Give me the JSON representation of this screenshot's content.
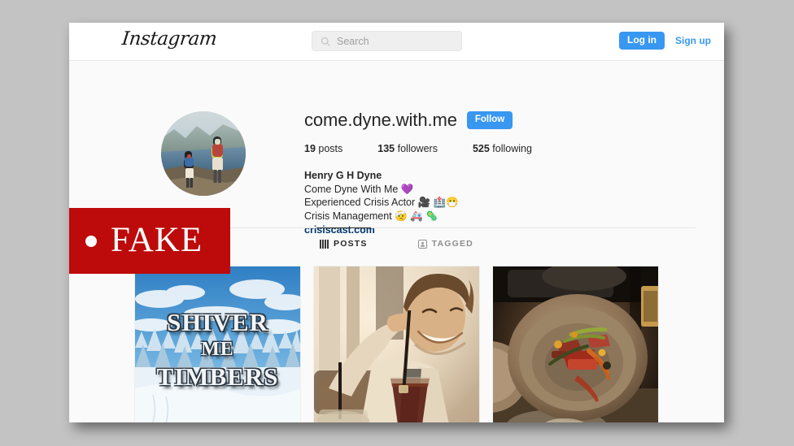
{
  "window": {
    "background_color": "#fafafa",
    "page_backdrop_color": "#c3c3c3"
  },
  "navbar": {
    "logo_text": "Instagram",
    "search": {
      "placeholder": "Search",
      "value": "",
      "icon": "search-icon"
    },
    "login_label": "Log in",
    "signup_label": "Sign up",
    "accent_color": "#3897f0"
  },
  "profile": {
    "avatar_alt": "two hikers with backpacks on a mountain overlook",
    "username": "come.dyne.with.me",
    "follow_label": "Follow",
    "stats": [
      {
        "value": "19",
        "label": "posts"
      },
      {
        "value": "135",
        "label": "followers"
      },
      {
        "value": "525",
        "label": "following"
      }
    ],
    "full_name": "Henry G H Dyne",
    "bio_lines": [
      "Come Dyne With Me 💜",
      "Experienced Crisis Actor 🎥 🏥😷",
      "Crisis Management 🤕 🚑 🦠"
    ],
    "website": "crisiscast.com",
    "website_color": "#00376b"
  },
  "overlay": {
    "fake_label": "FAKE",
    "background_color": "#bd0a0a",
    "text_color": "#ffffff",
    "bullet": "•"
  },
  "tabs": [
    {
      "label": "POSTS",
      "icon": "grid-icon",
      "active": true
    },
    {
      "label": "TAGGED",
      "icon": "tagged-person-icon",
      "active": false
    }
  ],
  "posts": [
    {
      "alt": "snow covered pine forest under a blue sky",
      "caption_lines": [
        "SHIVER",
        "ME",
        "TIMBERS"
      ]
    },
    {
      "alt": "sepia toned photo of a smiling man holding a tall glass of iced drink at an outdoor cafe",
      "caption_lines": []
    },
    {
      "alt": "plated restaurant dish of sliced meat and vegetables on a stone bowl in dim light",
      "caption_lines": []
    }
  ]
}
